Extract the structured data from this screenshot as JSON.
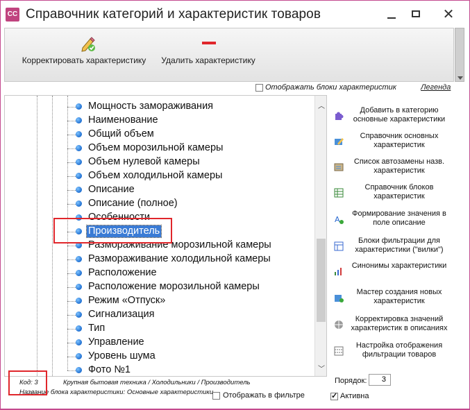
{
  "window": {
    "app_icon_text": "CC",
    "title": "Справочник категорий и характеристик товаров",
    "minimize": "—",
    "maximize": "□",
    "close": "✕"
  },
  "toolbar": {
    "edit_label": "Корректировать характеристику",
    "delete_label": "Удалить характеристику"
  },
  "options": {
    "show_blocks_label": "Отображать блоки характеристик",
    "show_blocks_checked": false,
    "legend_label": "Легенда"
  },
  "tree": {
    "items": [
      "Мощность замораживания",
      "Наименование",
      "Общий объем",
      "Объем морозильной камеры",
      "Объем нулевой камеры",
      "Объем холодильной камеры",
      "Описание",
      "Описание (полное)",
      "Особенности",
      "Производитель",
      "Размораживание морозильной камеры",
      "Размораживание холодильной камеры",
      "Расположение",
      "Расположение морозильной камеры",
      "Режим «Отпуск»",
      "Сигнализация",
      "Тип",
      "Управление",
      "Уровень шума",
      "Фото №1"
    ],
    "selected": "Производитель"
  },
  "actions": [
    {
      "label": "Добавить в категорию основные характеристики",
      "icon": "puzzle-icon"
    },
    {
      "label": "Справочник основных характеристик",
      "icon": "book-edit-icon"
    },
    {
      "label": "Список автозамены назв. характеристик",
      "icon": "list-replace-icon"
    },
    {
      "label": "Справочник блоков характеристик",
      "icon": "table-icon"
    },
    {
      "label": "Формирование значения в поле описание",
      "icon": "text-format-icon"
    },
    {
      "label": "Блоки фильтрации для характеристики (\"вилки\")",
      "icon": "filter-block-icon"
    },
    {
      "label": "Синонимы характеристики",
      "icon": "chart-icon"
    },
    {
      "label": "Мастер создания новых характеристик",
      "icon": "wizard-icon"
    },
    {
      "label": "Корректировка значений характеристик в описаниях",
      "icon": "globe-icon"
    },
    {
      "label": "Настройка отображения фильтрации товаров",
      "icon": "settings-grid-icon"
    }
  ],
  "status": {
    "code": "Код: 3",
    "path": "Крупная бытовая техника / Холодильники / Производитель",
    "block": "Название блока характеристики: Основные характеристики",
    "show_in_filter_label": "Отображать в фильтре",
    "show_in_filter_checked": false,
    "order_label": "Порядок:",
    "order_value": "3",
    "active_label": "Активна",
    "active_checked": true
  },
  "colors": {
    "accent_border": "#c3498e",
    "highlight": "#e0262b",
    "selection": "#3a7bd5"
  }
}
